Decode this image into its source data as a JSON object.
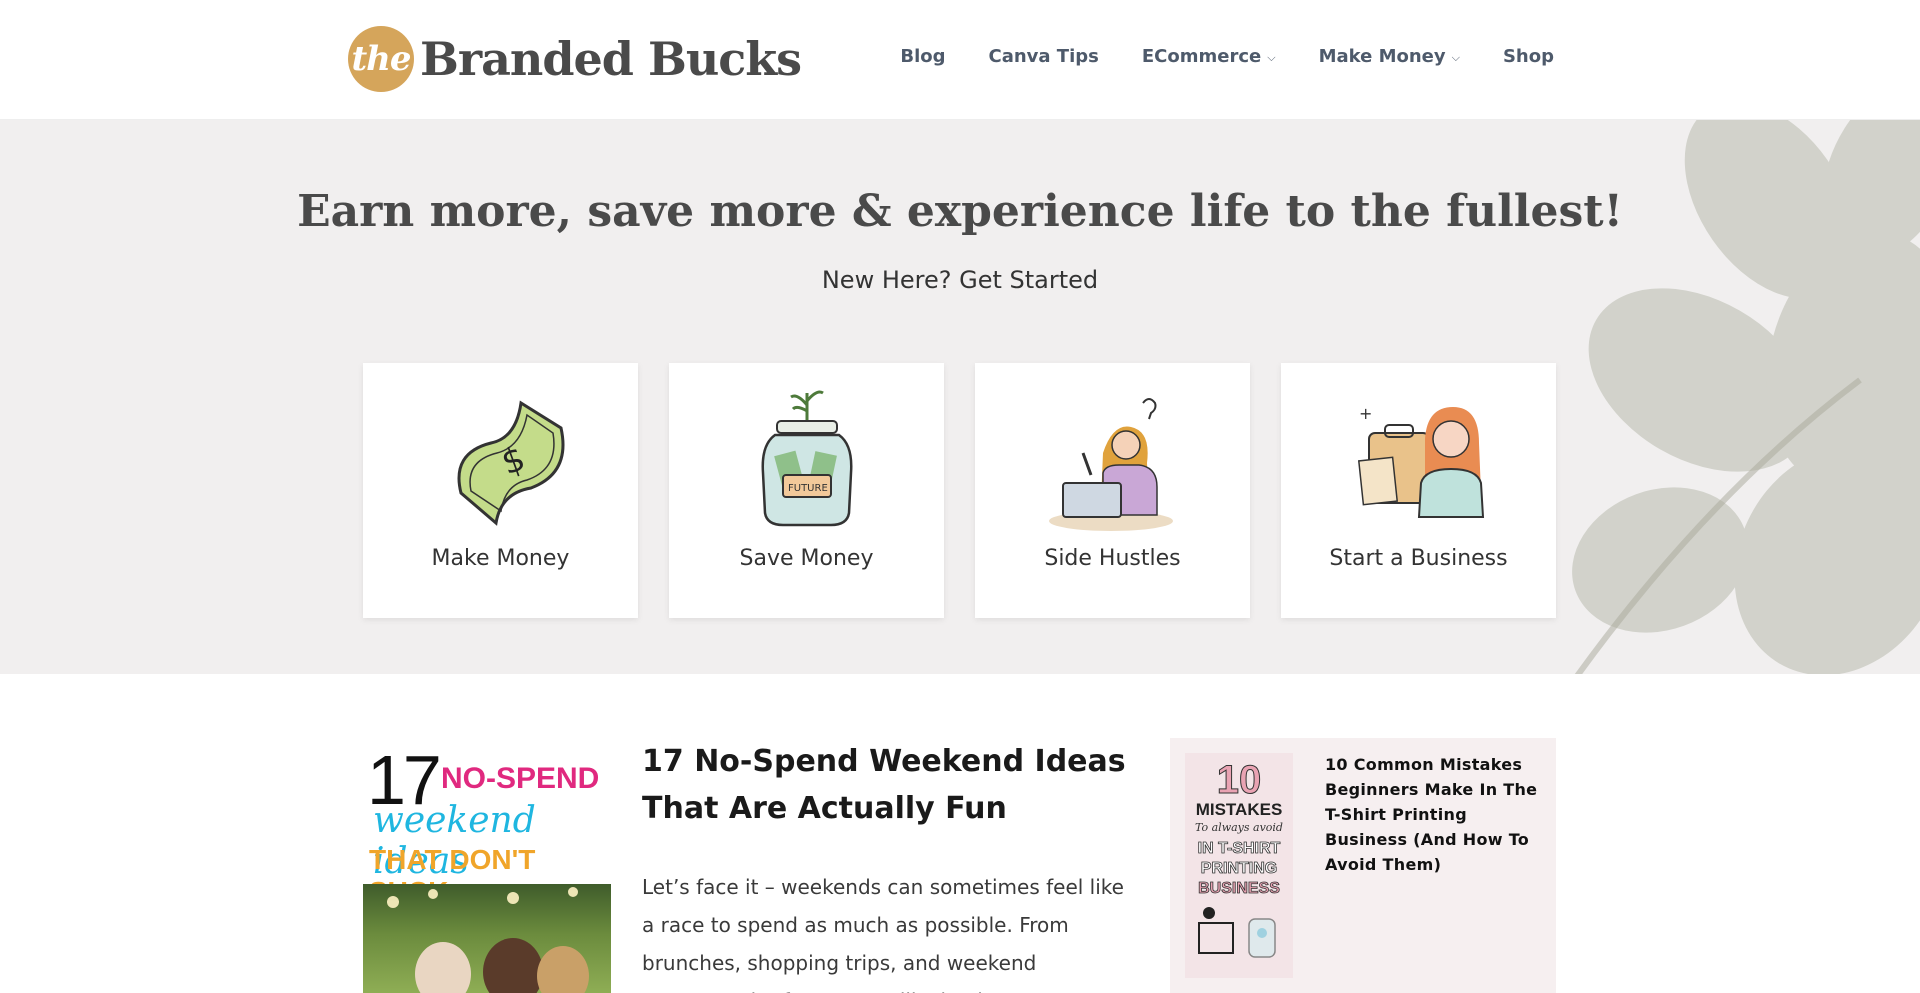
{
  "header": {
    "logo_badge": "the",
    "logo_text": "Branded Bucks",
    "nav": [
      {
        "label": "Blog",
        "dropdown": false
      },
      {
        "label": "Canva Tips",
        "dropdown": false
      },
      {
        "label": "ECommerce",
        "dropdown": true
      },
      {
        "label": "Make Money",
        "dropdown": true
      },
      {
        "label": "Shop",
        "dropdown": false
      }
    ],
    "chevron": "⌵"
  },
  "hero": {
    "title": "Earn more, save more & experience life to the fullest!",
    "subtitle": "New Here? Get Started",
    "cards": [
      {
        "label": "Make Money",
        "icon": "dollar-bill-icon"
      },
      {
        "label": "Save Money",
        "icon": "savings-jar-icon"
      },
      {
        "label": "Side Hustles",
        "icon": "woman-laptop-icon"
      },
      {
        "label": "Start a Business",
        "icon": "businesswoman-briefcase-icon"
      }
    ]
  },
  "posts": {
    "featured": {
      "thumb": {
        "number": "17",
        "line1": "NO-SPEND",
        "line2": "weekend ideas",
        "line3": "THAT DON'T SUCK"
      },
      "title": "17 No-Spend Weekend Ideas That Are Actually Fun",
      "excerpt": "Let’s face it – weekends can sometimes feel like a race to spend as much as possible. From brunches, shopping trips, and weekend getaways, it often seems like having"
    },
    "sidebar": {
      "thumb": {
        "number": "10",
        "line1": "MISTAKES",
        "line2": "To always avoid",
        "line3": "IN T-SHIRT",
        "line4": "PRINTING",
        "line5": "BUSINESS"
      },
      "title": "10 Common Mistakes Beginners Make In The T-Shirt Printing Business (And How To Avoid Them)"
    }
  },
  "colors": {
    "accent": "#d5a55b",
    "hero_bg": "#f1efef",
    "nav_text": "#4e5a6b",
    "pink": "#e0297f",
    "cyan": "#1fb6e0",
    "orange": "#f0a52a"
  }
}
